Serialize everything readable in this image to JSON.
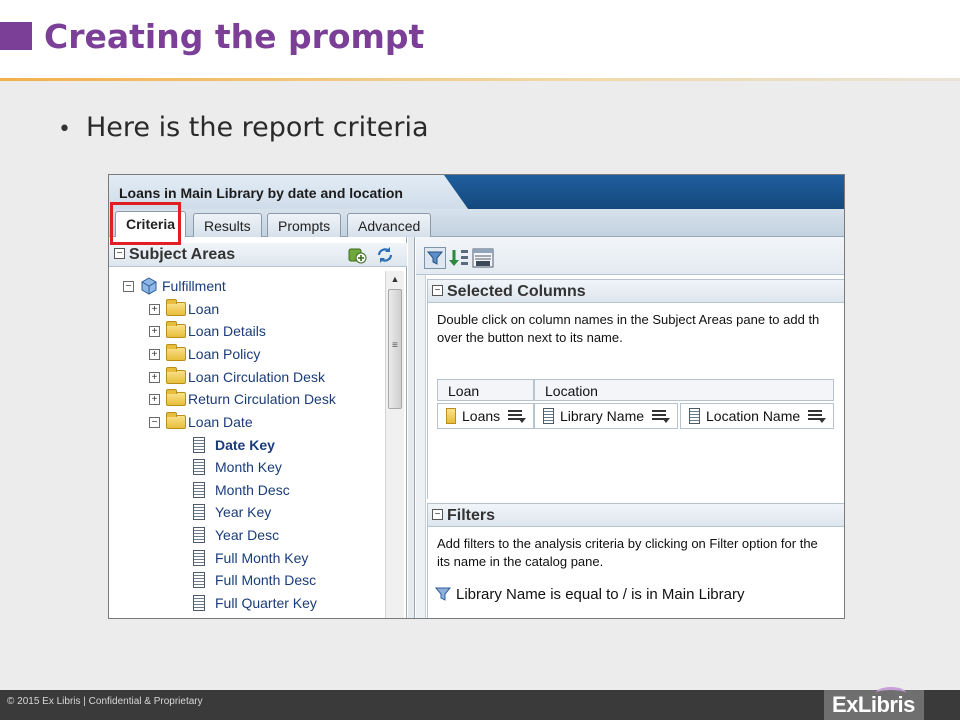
{
  "slide": {
    "title": "Creating the prompt",
    "bullet": "Here is the report criteria",
    "footer": "© 2015 Ex Libris | Confidential & Proprietary",
    "logo": "ExLibris"
  },
  "report": {
    "title": "Loans in Main Library by date and location",
    "tabs": [
      "Criteria",
      "Results",
      "Prompts",
      "Advanced"
    ],
    "active_tab": "Criteria"
  },
  "subject_areas": {
    "title": "Subject Areas",
    "root": "Fulfillment",
    "folders": [
      "Loan",
      "Loan Details",
      "Loan Policy",
      "Loan Circulation Desk",
      "Return Circulation Desk",
      "Loan Date"
    ],
    "loan_date_columns": [
      "Date Key",
      "Month Key",
      "Month Desc",
      "Year Key",
      "Year Desc",
      "Full Month Key",
      "Full Month Desc",
      "Full Quarter Key"
    ]
  },
  "selected_columns": {
    "title": "Selected Columns",
    "desc_line1": "Double click on column names in the Subject Areas pane to add th",
    "desc_line2": "over the button next to its name.",
    "groups": [
      "Loan",
      "Location"
    ],
    "columns": [
      "Loans",
      "Library Name",
      "Location Name"
    ]
  },
  "filters": {
    "title": "Filters",
    "desc_line1": "Add filters to the analysis criteria by clicking on Filter option for the",
    "desc_line2": "its name in the catalog pane.",
    "filter_text": "Library Name is equal to / is in  Main Library"
  },
  "colors": {
    "brand_purple": "#7b3f98",
    "highlight_red": "#e01e24",
    "header_blue": "#1f5f9f",
    "link_blue": "#1a3c7a"
  },
  "icons": {
    "expand": "plus-box-icon",
    "collapse": "minus-box-icon",
    "folder": "folder-icon",
    "column": "column-icon",
    "subject_area": "cube-icon",
    "filter": "filter-funnel-icon"
  }
}
